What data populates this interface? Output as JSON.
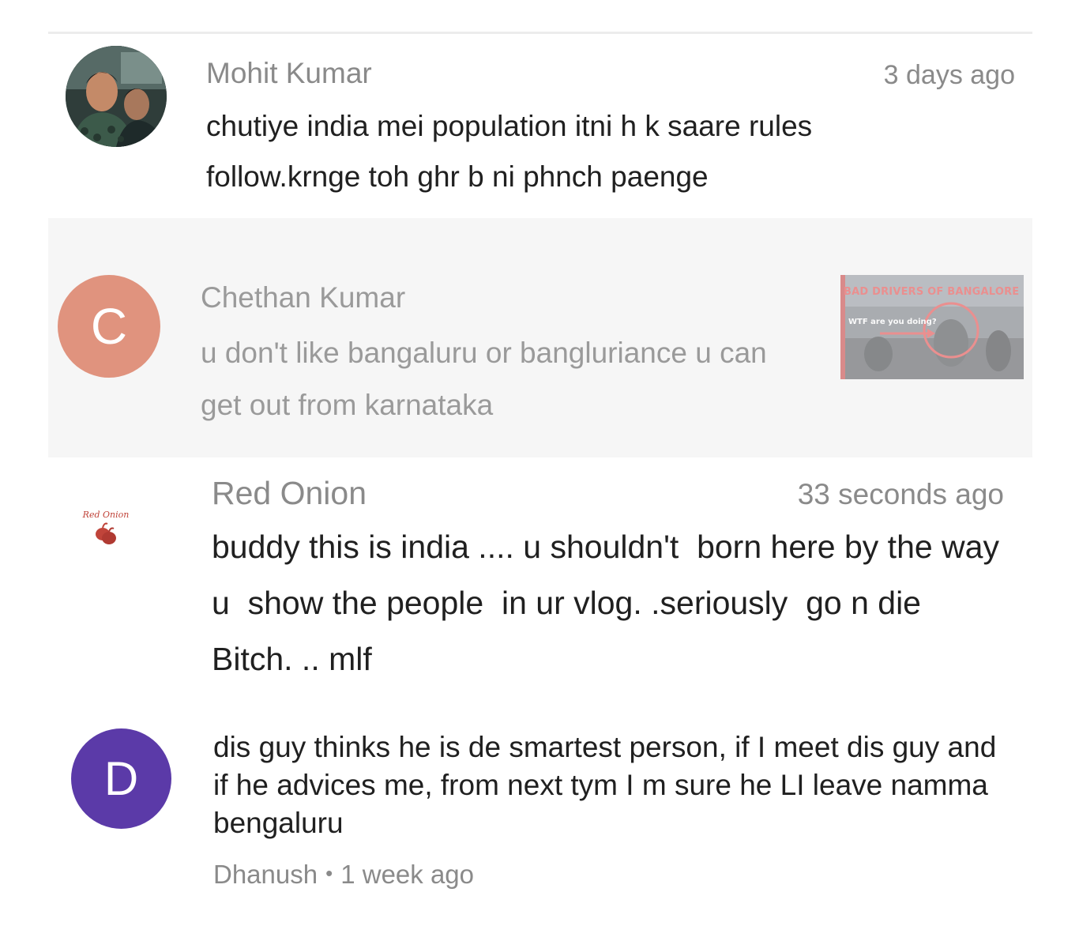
{
  "comments": [
    {
      "author": "Mohit Kumar",
      "time": "3 days ago",
      "text": "chutiye india mei population itni h k saare rules follow.krnge toh ghr b ni phnch paenge",
      "avatar": "profile-photo"
    },
    {
      "author": "Chethan Kumar",
      "text": "u don't like bangaluru or bangluriance u can get out from karnataka",
      "avatar_letter": "C",
      "avatar_color": "#e0937e",
      "thumbnail": {
        "title": "BAD DRIVERS OF BANGALORE",
        "subtitle": "WTF are you doing?"
      }
    },
    {
      "author": "Red Onion",
      "time": "33 seconds ago",
      "text": "buddy this is india .... u shouldn't  born here by the way u  show the people  in ur vlog. .seriously  go n die Bitch. .. mlf",
      "avatar_logo_text": "Red Onion"
    },
    {
      "author": "Dhanush",
      "time": "1 week ago",
      "text": "dis guy thinks he is de smartest person, if I meet dis guy and if he advices me, from next tym I m sure he LI leave namma bengaluru",
      "avatar_letter": "D",
      "avatar_color": "#5b3aa8",
      "separator": "•"
    }
  ]
}
